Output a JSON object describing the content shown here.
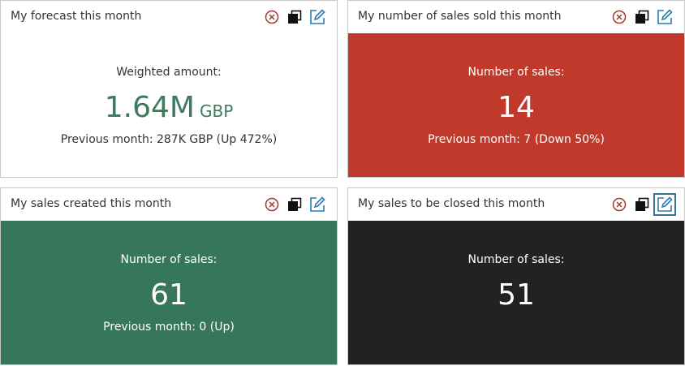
{
  "widgets": [
    {
      "title": "My forecast this month",
      "label": "Weighted amount:",
      "value": "1.64M",
      "unit": "GBP",
      "previous": "Previous month: 287K GBP (Up 472%)",
      "body_color": "#ffffff"
    },
    {
      "title": "My number of sales sold this month",
      "label": "Number of sales:",
      "value": "14",
      "previous": "Previous month: 7 (Down 50%)",
      "body_color": "#c0392b"
    },
    {
      "title": "My sales created this month",
      "label": "Number of sales:",
      "value": "61",
      "previous": "Previous month: 0 (Up)",
      "body_color": "#36775b"
    },
    {
      "title": "My sales to be closed this month",
      "label": "Number of sales:",
      "value": "51",
      "body_color": "#222222"
    }
  ],
  "icons": {
    "close": "close-circle-icon",
    "copy": "copy-icon",
    "edit": "edit-icon"
  },
  "colors": {
    "close_icon": "#a33a2a",
    "edit_icon": "#2a7ab0",
    "value_green": "#3d7a5e"
  }
}
